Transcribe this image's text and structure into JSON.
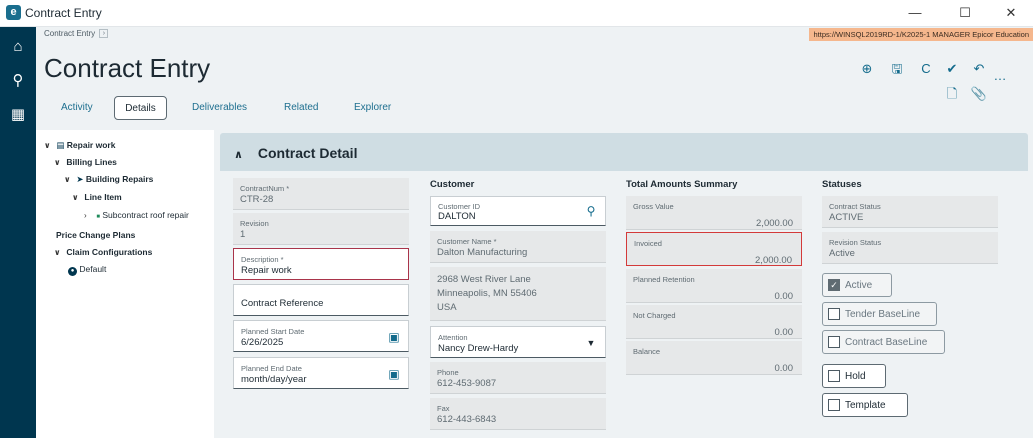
{
  "window": {
    "title": "Contract Entry",
    "logo_letter": "e",
    "minimize": "—",
    "maximize": "☐",
    "close": "✕"
  },
  "rail": {
    "home_icon": "⌂",
    "search_icon": "⚲",
    "apps_icon": "▦"
  },
  "breadcrumb": {
    "item": "Contract Entry",
    "chevron": "›"
  },
  "connection": {
    "text": "https://WINSQL2019RD-1/K2025-1  MANAGER  Epicor Education"
  },
  "page": {
    "title": "Contract Entry"
  },
  "toolbar": {
    "add": "⊕",
    "save": "🖫",
    "refresh": "C",
    "clear": "✔",
    "undo": "↶",
    "more": "…",
    "new_doc": "🗋",
    "attach": "📎"
  },
  "tabs": [
    {
      "label": "Activity"
    },
    {
      "label": "Details"
    },
    {
      "label": "Deliverables"
    },
    {
      "label": "Related"
    },
    {
      "label": "Explorer"
    }
  ],
  "tree": {
    "root": "Repair work",
    "billing_lines": "Billing Lines",
    "building_repairs": "Building Repairs",
    "line_item": "Line Item",
    "subcontract": "Subcontract roof repair",
    "price_change": "Price Change Plans",
    "claim_config": "Claim Configurations",
    "default": "Default"
  },
  "section": {
    "title": "Contract Detail"
  },
  "contract": {
    "contractnum_label": "ContractNum *",
    "contractnum": "CTR-28",
    "revision_label": "Revision",
    "revision": "1",
    "description_label": "Description *",
    "description": "Repair work",
    "reference_placeholder": "Contract Reference",
    "start_label": "Planned Start Date",
    "start": "6/26/2025",
    "end_label": "Planned End Date",
    "end": "month/day/year"
  },
  "customer": {
    "heading": "Customer",
    "id_label": "Customer ID",
    "id": "DALTON",
    "name_label": "Customer Name *",
    "name": "Dalton Manufacturing",
    "addr1": "2968 West River Lane",
    "addr2": "Minneapolis, MN  55406",
    "addr3": "USA",
    "attention_label": "Attention",
    "attention": "Nancy Drew-Hardy",
    "phone_label": "Phone",
    "phone": "612-453-9087",
    "fax_label": "Fax",
    "fax": "612-443-6843"
  },
  "totals": {
    "heading": "Total Amounts Summary",
    "gross_label": "Gross Value",
    "gross": "2,000.00",
    "invoiced_label": "Invoiced",
    "invoiced": "2,000.00",
    "retention_label": "Planned Retention",
    "retention": "0.00",
    "notcharged_label": "Not Charged",
    "notcharged": "0.00",
    "balance_label": "Balance",
    "balance": "0.00"
  },
  "statuses": {
    "heading": "Statuses",
    "contract_label": "Contract Status",
    "contract": "ACTIVE",
    "revision_label": "Revision Status",
    "revision": "Active",
    "active": "Active",
    "tender": "Tender BaseLine",
    "baseline": "Contract BaseLine",
    "hold": "Hold",
    "template": "Template",
    "check_mark": "✓"
  },
  "colors": {
    "rail": "#00364f",
    "accent": "#136b8c",
    "invoiced_outline": "#d33a3a",
    "connection_bar": "#f5b78d"
  }
}
